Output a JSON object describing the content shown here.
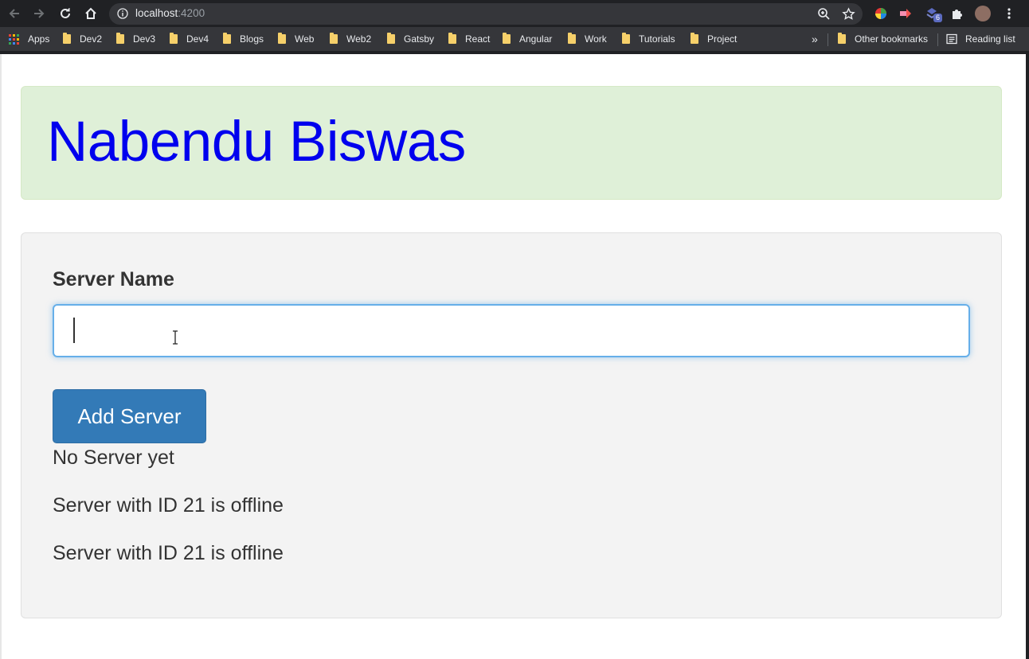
{
  "browser": {
    "url_host": "localhost",
    "url_port": ":4200",
    "extension_badge": "6",
    "bookmarks": [
      {
        "label": "Apps",
        "type": "apps"
      },
      {
        "label": "Dev2",
        "type": "folder"
      },
      {
        "label": "Dev3",
        "type": "folder"
      },
      {
        "label": "Dev4",
        "type": "folder"
      },
      {
        "label": "Blogs",
        "type": "folder"
      },
      {
        "label": "Web",
        "type": "folder"
      },
      {
        "label": "Web2",
        "type": "folder"
      },
      {
        "label": "Gatsby",
        "type": "folder"
      },
      {
        "label": "React",
        "type": "folder"
      },
      {
        "label": "Angular",
        "type": "folder"
      },
      {
        "label": "Work",
        "type": "folder"
      },
      {
        "label": "Tutorials",
        "type": "folder"
      },
      {
        "label": "Project",
        "type": "folder"
      }
    ],
    "overflow_label": "»",
    "other_bookmarks": "Other bookmarks",
    "reading_list": "Reading list"
  },
  "page": {
    "heading": "Nabendu Biswas",
    "form": {
      "label": "Server Name",
      "input_value": "",
      "button_label": "Add Server"
    },
    "status_lines": [
      "No Server yet",
      "Server with ID 21 is offline",
      "Server with ID 21 is offline"
    ]
  },
  "colors": {
    "chrome_dark": "#202124",
    "bookmarks_bar": "#35363a",
    "jumbotron_bg": "#dff0d8",
    "heading": "#0000ee",
    "well_bg": "#f3f3f3",
    "button_bg": "#337ab7",
    "input_focus": "#66afe9"
  }
}
